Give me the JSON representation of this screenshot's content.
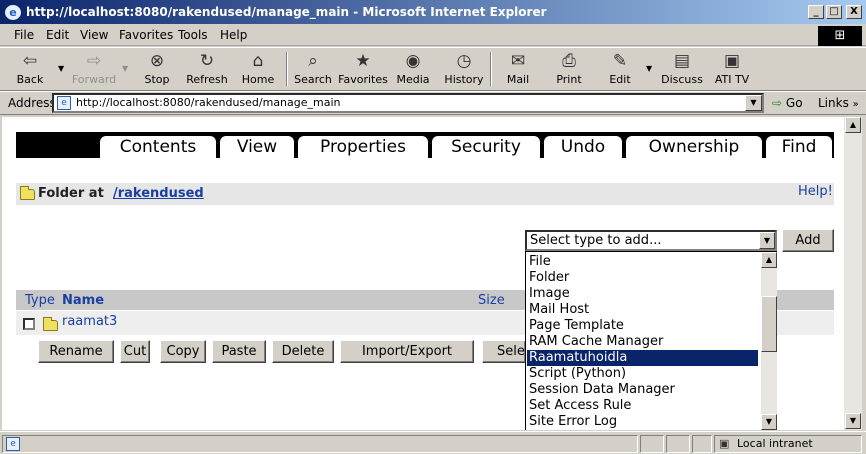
{
  "window": {
    "title": "http://localhost:8080/rakendused/manage_main - Microsoft Internet Explorer",
    "minimize": "_",
    "maximize": "□",
    "close": "X"
  },
  "menu": [
    {
      "label": "File"
    },
    {
      "label": "Edit"
    },
    {
      "label": "View"
    },
    {
      "label": "Favorites"
    },
    {
      "label": "Tools"
    },
    {
      "label": "Help"
    }
  ],
  "toolbar": {
    "back": "Back",
    "forward": "Forward",
    "stop": "Stop",
    "refresh": "Refresh",
    "home": "Home",
    "search": "Search",
    "favorites": "Favorites",
    "media": "Media",
    "history": "History",
    "mail": "Mail",
    "print": "Print",
    "edit": "Edit",
    "discuss": "Discuss",
    "ati": "ATI TV"
  },
  "address": {
    "label": "Address",
    "url": "http://localhost:8080/rakendused/manage_main",
    "go": "Go",
    "links": "Links"
  },
  "tabs": [
    "Contents",
    "View",
    "Properties",
    "Security",
    "Undo",
    "Ownership",
    "Find"
  ],
  "folder": {
    "prefix": "Folder at",
    "path": "/rakendused",
    "help": "Help!"
  },
  "add": {
    "selected": "Select type to add...",
    "button": "Add"
  },
  "list": {
    "col_type": "Type",
    "col_name": "Name",
    "col_size": "Size",
    "items": [
      {
        "name": "raamat3"
      }
    ]
  },
  "actions": [
    "Rename",
    "Cut",
    "Copy",
    "Paste",
    "Delete",
    "Import/Export",
    "Sele"
  ],
  "dropdown": {
    "options": [
      "File",
      "Folder",
      "Image",
      "Mail Host",
      "Page Template",
      "RAM Cache Manager",
      "Raamatuhoidla",
      "Script (Python)",
      "Session Data Manager",
      "Set Access Rule",
      "Site Error Log"
    ],
    "highlighted": "Raamatuhoidla"
  },
  "status": {
    "zone": "Local intranet"
  },
  "colors": {
    "link": "#1a3fa0",
    "highlight": "#0a246a"
  }
}
